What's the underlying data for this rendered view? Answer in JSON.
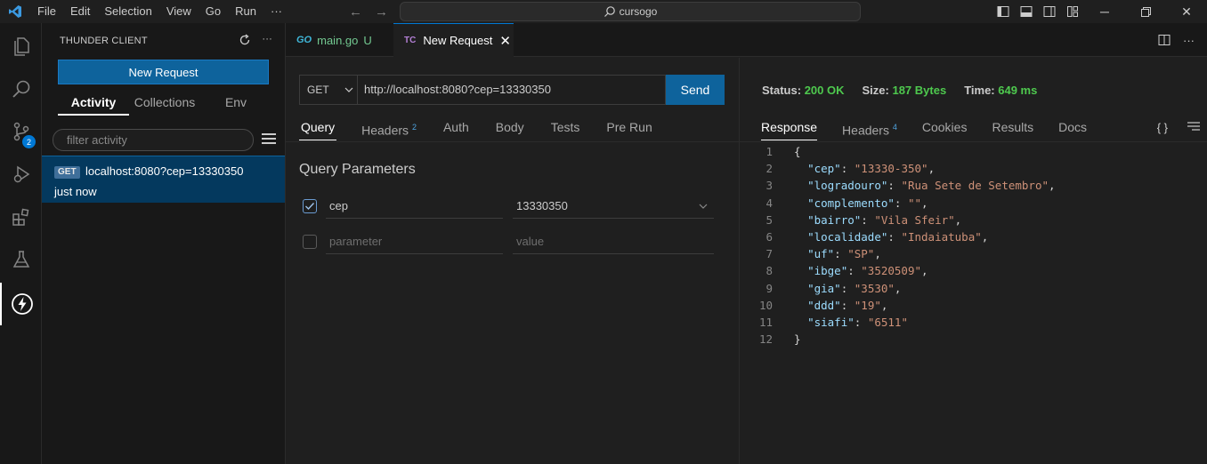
{
  "menu": [
    "File",
    "Edit",
    "Selection",
    "View",
    "Go",
    "Run",
    "···"
  ],
  "command_center": {
    "text": "cursogo"
  },
  "activity_bar": {
    "scm_badge": "2"
  },
  "sidebar": {
    "title": "THUNDER CLIENT",
    "new_request_label": "New Request",
    "tabs": [
      "Activity",
      "Collections",
      "Env"
    ],
    "filter_placeholder": "filter activity",
    "activity": {
      "method": "GET",
      "url": "localhost:8080?cep=13330350",
      "time": "just now"
    }
  },
  "editor_tabs": [
    {
      "icon": "GO",
      "label": "main.go",
      "status": "U"
    },
    {
      "icon": "TC",
      "label": "New Request",
      "close": "✕"
    }
  ],
  "request": {
    "method": "GET",
    "url": "http://localhost:8080?cep=13330350",
    "send_label": "Send",
    "tabs": {
      "query": "Query",
      "headers": "Headers",
      "headers_count": "2",
      "auth": "Auth",
      "body": "Body",
      "tests": "Tests",
      "prerun": "Pre Run"
    },
    "query_title": "Query Parameters",
    "params": [
      {
        "name": "cep",
        "value": "13330350",
        "checked": true
      }
    ],
    "new_param": {
      "name_placeholder": "parameter",
      "value_placeholder": "value"
    }
  },
  "response": {
    "status_label": "Status:",
    "status_value": "200 OK",
    "size_label": "Size:",
    "size_value": "187 Bytes",
    "time_label": "Time:",
    "time_value": "649 ms",
    "tabs": {
      "response": "Response",
      "headers": "Headers",
      "headers_count": "4",
      "cookies": "Cookies",
      "results": "Results",
      "docs": "Docs"
    },
    "braces_label": "{ }",
    "body_lines": [
      {
        "n": "1",
        "open": "{"
      },
      {
        "n": "2",
        "key": "\"cep\"",
        "val": "\"13330-350\"",
        "comma": ","
      },
      {
        "n": "3",
        "key": "\"logradouro\"",
        "val": "\"Rua Sete de Setembro\"",
        "comma": ","
      },
      {
        "n": "4",
        "key": "\"complemento\"",
        "val": "\"\"",
        "comma": ","
      },
      {
        "n": "5",
        "key": "\"bairro\"",
        "val": "\"Vila Sfeir\"",
        "comma": ","
      },
      {
        "n": "6",
        "key": "\"localidade\"",
        "val": "\"Indaiatuba\"",
        "comma": ","
      },
      {
        "n": "7",
        "key": "\"uf\"",
        "val": "\"SP\"",
        "comma": ","
      },
      {
        "n": "8",
        "key": "\"ibge\"",
        "val": "\"3520509\"",
        "comma": ","
      },
      {
        "n": "9",
        "key": "\"gia\"",
        "val": "\"3530\"",
        "comma": ","
      },
      {
        "n": "10",
        "key": "\"ddd\"",
        "val": "\"19\"",
        "comma": ","
      },
      {
        "n": "11",
        "key": "\"siafi\"",
        "val": "\"6511\"",
        "comma": ""
      },
      {
        "n": "12",
        "open": "}"
      }
    ]
  },
  "colors": {
    "accent": "#0e639c",
    "ok": "#4ec94e",
    "key": "#9cdcfe",
    "string": "#ce9178"
  }
}
